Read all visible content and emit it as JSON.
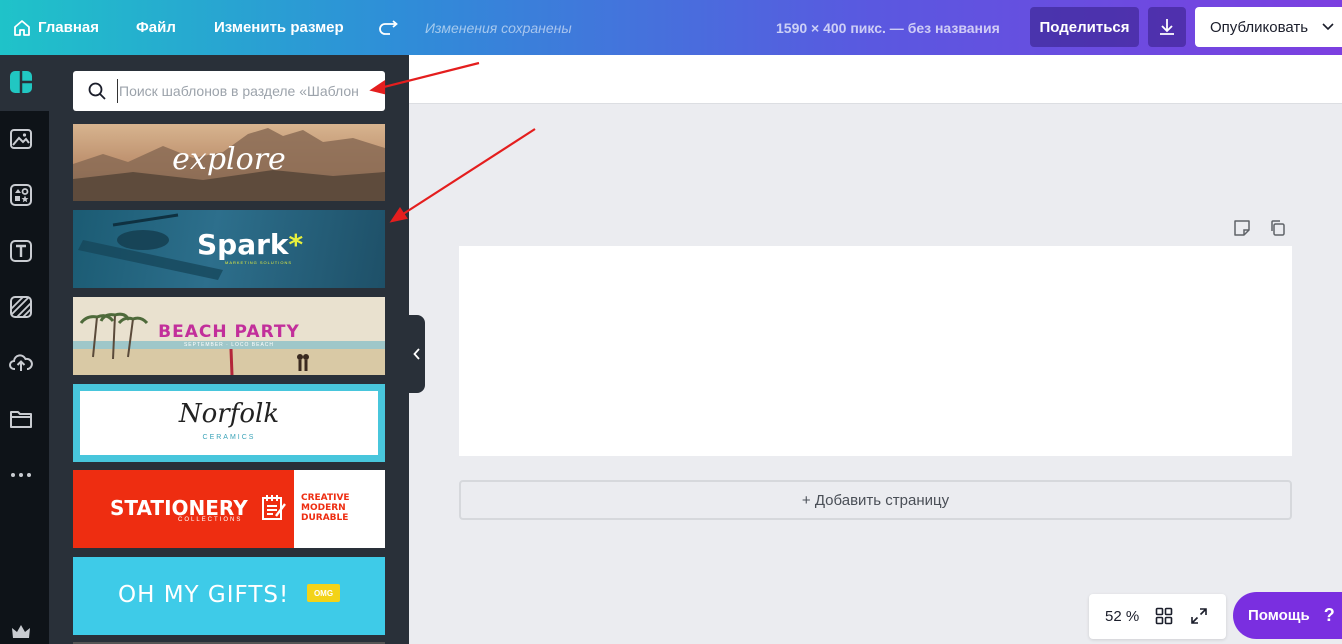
{
  "topbar": {
    "home_label": "Главная",
    "file_label": "Файл",
    "resize_label": "Изменить размер",
    "saved_status": "Изменения сохранены",
    "doc_info": "1590 × 400 пикс. — без названия",
    "share_label": "Поделиться",
    "publish_label": "Опубликовать"
  },
  "rail": {
    "items": [
      "templates-icon",
      "photos-icon",
      "elements-icon",
      "text-icon",
      "background-icon",
      "uploads-icon",
      "folders-icon",
      "more-icon",
      "premium-crown-icon"
    ]
  },
  "panel": {
    "search_placeholder": "Поиск шаблонов в разделе «Шаблон",
    "templates": [
      {
        "title": "explore"
      },
      {
        "title": "Spark",
        "accent": "*",
        "subtitle": "MARKETING SOLUTIONS"
      },
      {
        "title": "BEACH PARTY",
        "subtitle": "SEPTEMBER · LOCO BEACH"
      },
      {
        "title": "Norfolk",
        "subtitle": "CERAMICS"
      },
      {
        "title": "STATIONERY",
        "subtitle": "COLLECTIONS",
        "side_lines": [
          "CREATIVE",
          "MODERN",
          "DURABLE"
        ]
      },
      {
        "title": "OH MY GIFTS!",
        "badge": "OMG"
      }
    ]
  },
  "canvas": {
    "add_page_label": "+ Добавить страницу"
  },
  "footer": {
    "zoom_label": "52 %",
    "help_label": "Помощь",
    "help_icon": "?"
  },
  "colors": {
    "accent_red_arrow": "#e41e1e",
    "help_purple": "#7a2fe0",
    "panel_bg": "#293039",
    "rail_bg": "#0e1318"
  }
}
